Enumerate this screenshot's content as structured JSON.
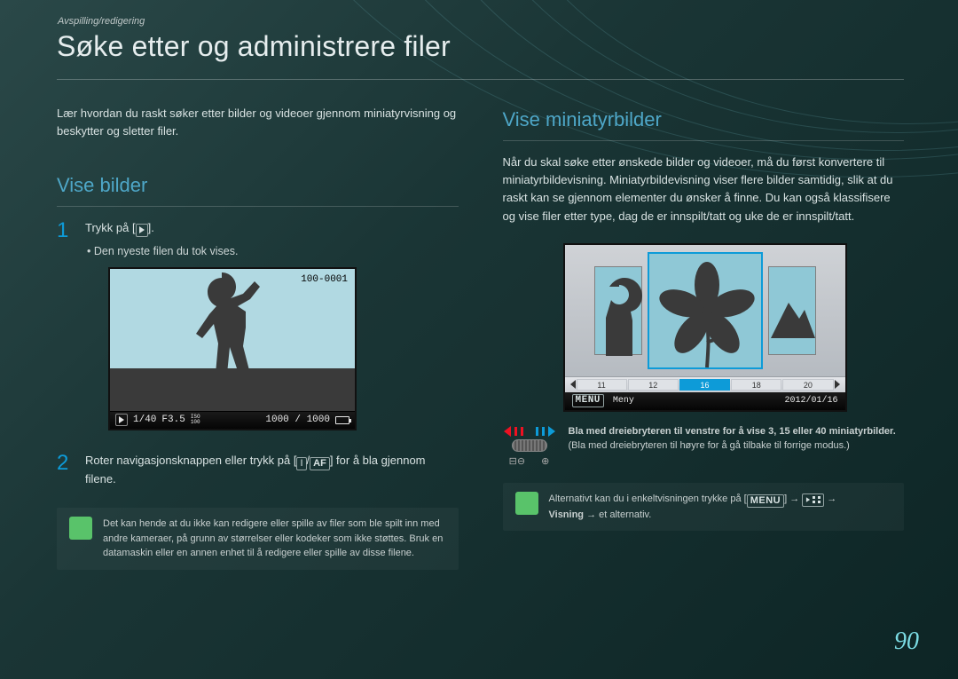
{
  "breadcrumb": "Avspilling/redigering",
  "page_title": "Søke etter og administrere filer",
  "page_number": "90",
  "left": {
    "intro": "Lær hvordan du raskt søker etter bilder og videoer gjennom miniatyrvisning og beskytter og sletter filer.",
    "heading": "Vise bilder",
    "step1": "Trykk på [",
    "step1_tail": "].",
    "step1_bullet": "Den nyeste filen du tok vises.",
    "step2_a": "Roter navigasjonsknappen eller trykk på [",
    "step2_mid": "/",
    "step2_af": "AF",
    "step2_b": "] for å bla gjennom filene.",
    "flower_icon": "I",
    "note": "Det kan hende at du ikke kan redigere eller spille av filer som ble spilt inn med andre kameraer, på grunn av størrelser eller kodeker som ikke støttes. Bruk en datamaskin eller en annen enhet til å redigere eller spille av disse filene.",
    "shot": {
      "corner": "100-0001",
      "ratio": "1/40",
      "f": "F3.5",
      "iso_top": "ISO",
      "iso_bot": "100",
      "shots": "1000 / 1000"
    }
  },
  "right": {
    "heading": "Vise miniatyrbilder",
    "intro": "Når du skal søke etter ønskede bilder og videoer, må du først konvertere til miniatyrbildevisning. Miniatyrbildevisning viser flere bilder samtidig, slik at du raskt kan se gjennom elementer du ønsker å finne. Du kan også klassifisere og vise filer etter type, dag de er innspilt/tatt og uke de er innspilt/tatt.",
    "strip": [
      "11",
      "12",
      "16",
      "18",
      "20"
    ],
    "meny": "Meny",
    "date": "2012/01/16",
    "dial_bold": "Bla med dreiebryteren til venstre for å vise 3, 15 eller 40 miniatyrbilder.",
    "dial_plain": "(Bla med dreiebryteren til høyre for å gå tilbake til forrige modus.)",
    "note_a": "Alternativt kan du i enkeltvisningen trykke på [",
    "note_menu": "MENU",
    "note_b": "] → ",
    "note_c": " → ",
    "note_visning": "Visning",
    "note_d": " → et alternativ."
  }
}
